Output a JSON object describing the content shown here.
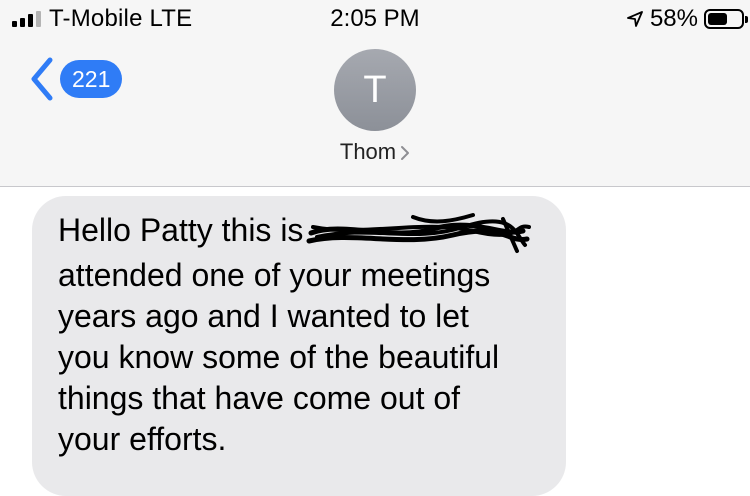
{
  "status_bar": {
    "carrier": "T-Mobile LTE",
    "time": "2:05 PM",
    "battery_percent": "58%",
    "battery_level": 0.58,
    "signal_bars": 3
  },
  "nav": {
    "back_badge": "221",
    "avatar_initial": "T",
    "contact_name": "Thom",
    "accent_color": "#2f7cf6"
  },
  "message": {
    "lines": [
      "Hello Patty this is",
      "attended one of your meetings",
      "years ago and I wanted to let",
      "you know some of the beautiful",
      "things that have come out of",
      "your efforts."
    ],
    "bubble_color": "#e9e9eb"
  }
}
